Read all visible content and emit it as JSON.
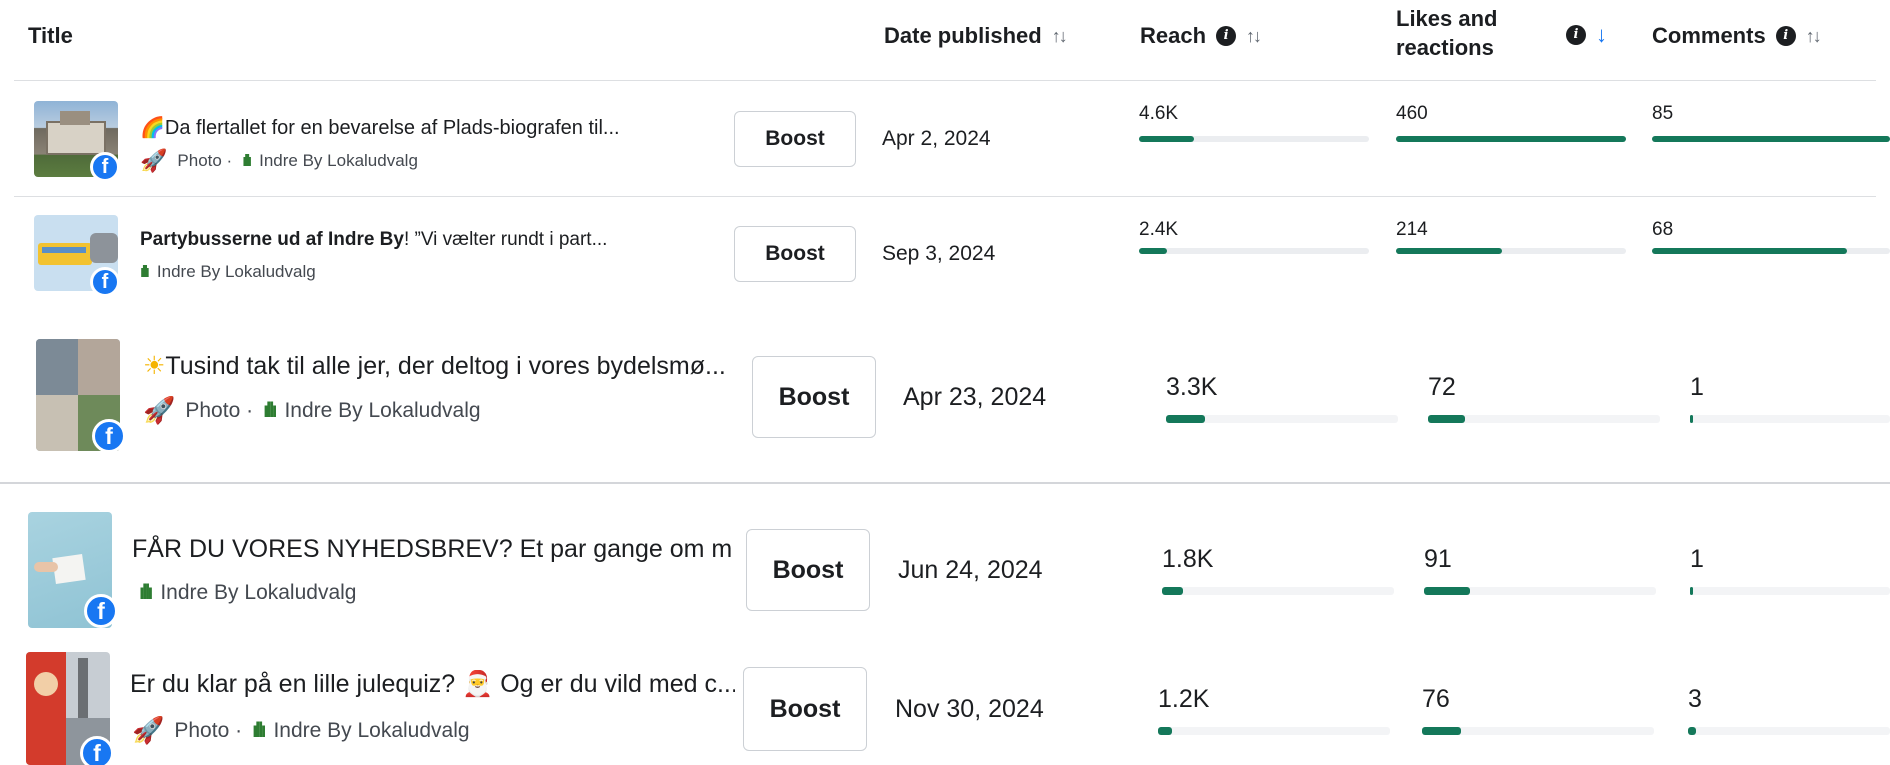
{
  "header": {
    "title": "Title",
    "date_published": "Date published",
    "reach": "Reach",
    "likes_line1": "Likes and",
    "likes_line2": "reactions",
    "comments": "Comments",
    "sort_both": "↑↓",
    "sort_down": "↓",
    "info_glyph": "i"
  },
  "posts": [
    {
      "emoji": "🌈",
      "title": "Da flertallet for en bevarelse af Plads-biografen til...",
      "title_bold": "",
      "type": "Photo ·",
      "page": "Indre By Lokaludvalg",
      "boost": "Boost",
      "date": "Apr 2, 2024",
      "reach": "4.6K",
      "likes": "460",
      "comments": "85",
      "reach_fraction": 0.24,
      "likes_fraction": 1.0,
      "comments_fraction": 1.0
    },
    {
      "emoji": "",
      "title_bold": "Partybusserne ud af Indre By",
      "title": "! ”Vi vælter rundt i part...",
      "type": "",
      "page": "Indre By Lokaludvalg",
      "boost": "Boost",
      "date": "Sep 3, 2024",
      "reach": "2.4K",
      "likes": "214",
      "comments": "68",
      "reach_fraction": 0.12,
      "likes_fraction": 0.46,
      "comments_fraction": 0.82
    },
    {
      "emoji": "☀",
      "title": "Tusind tak til alle jer, der deltog i vores bydelsmø...",
      "title_bold": "",
      "type": "Photo ·",
      "page": "Indre By Lokaludvalg",
      "boost": "Boost",
      "date": "Apr 23, 2024",
      "reach": "3.3K",
      "likes": "72",
      "comments": "1",
      "reach_fraction": 0.17,
      "likes_fraction": 0.16,
      "comments_fraction": 0.01
    },
    {
      "emoji": "",
      "title": "FÅR DU VORES NYHEDSBREV? Et par gange om mån...",
      "title_bold": "",
      "type": "",
      "page": "Indre By Lokaludvalg",
      "boost": "Boost",
      "date": "Jun 24, 2024",
      "reach": "1.8K",
      "likes": "91",
      "comments": "1",
      "reach_fraction": 0.09,
      "likes_fraction": 0.2,
      "comments_fraction": 0.01
    },
    {
      "emoji": "🎅",
      "title_pre": "Er du klar på en lille julequiz? ",
      "title": " Og er du vild med c...",
      "title_bold": "",
      "type": "Photo ·",
      "page": "Indre By Lokaludvalg",
      "boost": "Boost",
      "date": "Nov 30, 2024",
      "reach": "1.2K",
      "likes": "76",
      "comments": "3",
      "reach_fraction": 0.06,
      "likes_fraction": 0.17,
      "comments_fraction": 0.03
    }
  ],
  "icons": {
    "rocket": "rocket-icon",
    "page": "grass-page-icon",
    "facebook": "facebook-icon"
  },
  "colors": {
    "bar_fill": "#14785a",
    "bar_track": "#ebedf0",
    "facebook_blue": "#1877f2",
    "sort_active": "#1877f2"
  }
}
